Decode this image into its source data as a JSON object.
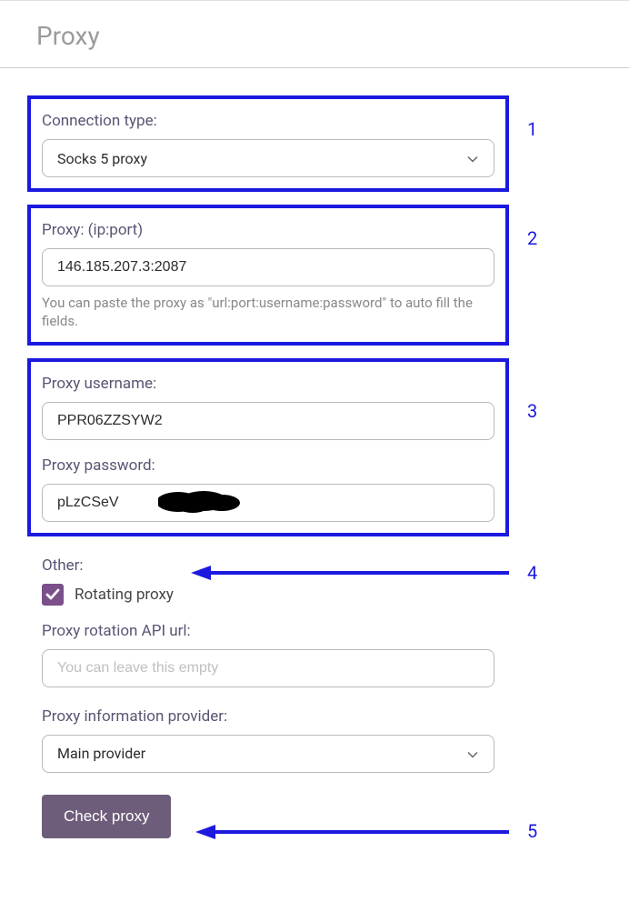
{
  "header": {
    "title": "Proxy"
  },
  "connection": {
    "label": "Connection type:",
    "value": "Socks 5 proxy"
  },
  "proxy": {
    "label": "Proxy: (ip:port)",
    "value": "146.185.207.3:2087",
    "helper": "You can paste the proxy as \"url:port:username:password\" to auto fill the fields."
  },
  "credentials": {
    "username_label": "Proxy username:",
    "username_value": "PPR06ZZSYW2",
    "password_label": "Proxy password:",
    "password_value": "pLzCSeV"
  },
  "other": {
    "label": "Other:",
    "rotating_label": "Rotating proxy",
    "rotating_checked": true,
    "rotation_url_label": "Proxy rotation API url:",
    "rotation_url_placeholder": "You can leave this empty",
    "provider_label": "Proxy information provider:",
    "provider_value": "Main provider"
  },
  "actions": {
    "check_label": "Check proxy"
  },
  "annotations": {
    "n1": "1",
    "n2": "2",
    "n3": "3",
    "n4": "4",
    "n5": "5"
  }
}
